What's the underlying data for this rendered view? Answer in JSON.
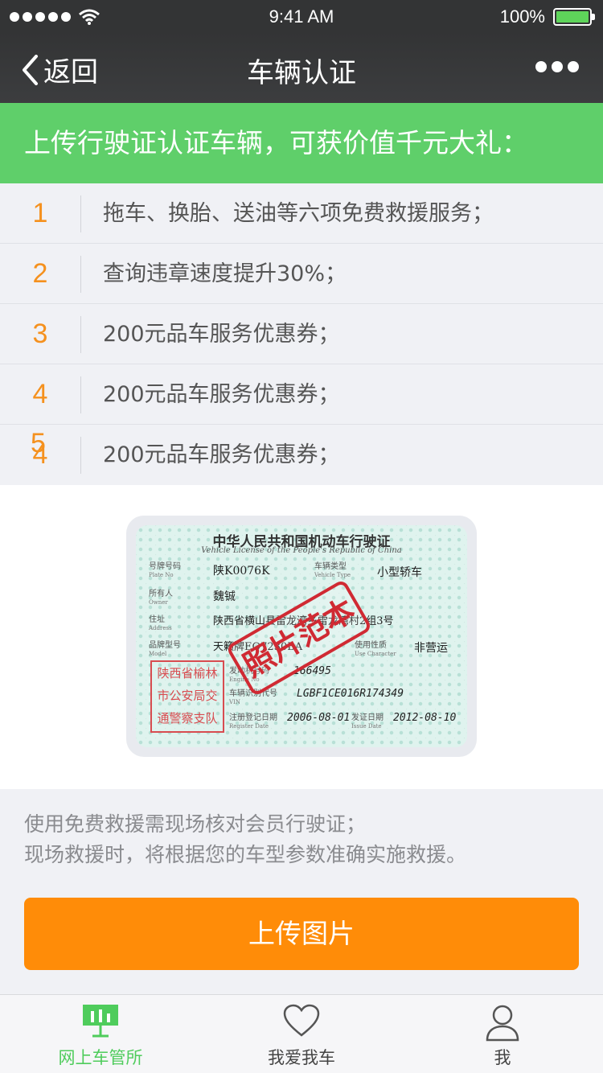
{
  "status_bar": {
    "time": "9:41 AM",
    "battery": "100%"
  },
  "nav": {
    "back_label": "返回",
    "title": "车辆认证"
  },
  "banner": {
    "text": "上传行驶证认证车辆，可获价值千元大礼："
  },
  "benefits": [
    {
      "num": "1",
      "text": "拖车、换胎、送油等六项免费救援服务；"
    },
    {
      "num": "2",
      "text": "查询违章速度提升30%；"
    },
    {
      "num": "3",
      "text": "200元品车服务优惠券；"
    },
    {
      "num": "4",
      "text": "200元品车服务优惠券；"
    },
    {
      "num": "4",
      "num_overlap": "5",
      "text": "200元品车服务优惠券；"
    }
  ],
  "license": {
    "title": "中华人民共和国机动车行驶证",
    "subtitle": "Vehicle License of the People's Republic of China",
    "plate_label": "号牌号码",
    "plate_label_en": "Plate No",
    "plate": "陕K0076K",
    "type_label": "车辆类型",
    "type_label_en": "Vehicle Type",
    "type": "小型轿车",
    "owner_label": "所有人",
    "owner_label_en": "Owner",
    "owner": "魏铖",
    "address_label": "住址",
    "address_label_en": "Address",
    "address": "陕西省横山县雷龙湾乡雷龙湾村2组3号",
    "model_label": "品牌型号",
    "model_label_en": "Model",
    "model": "天籁牌EQ7230BA",
    "use_label": "使用性质",
    "use_label_en": "Use Character",
    "use": "非营运",
    "engine_label": "发动机号码",
    "engine_label_en": "Engine No",
    "engine": "166495",
    "vin_label": "车辆识别代号",
    "vin_label_en": "VIN",
    "vin": "LGBF1CE016R174349",
    "register_label": "注册登记日期",
    "register_label_en": "Register Date",
    "register_date": "2006-08-01",
    "issue_label": "发证日期",
    "issue_label_en": "Issue Date",
    "issue_date": "2012-08-10",
    "seal": [
      "陕西省榆林",
      "市公安局交",
      "通警察支队"
    ],
    "stamp": "照片范本"
  },
  "note": {
    "line1": "使用免费救援需现场核对会员行驶证；",
    "line2": "现场救援时，将根据您的车型参数准确实施救援。"
  },
  "upload_button": "上传图片",
  "tabs": [
    {
      "label": "网上车管所",
      "icon": "chart-board-icon",
      "active": true
    },
    {
      "label": "我爱我车",
      "icon": "heart-icon",
      "active": false
    },
    {
      "label": "我",
      "icon": "user-icon",
      "active": false
    }
  ],
  "colors": {
    "accent_green": "#5fcf6a",
    "accent_orange": "#ff8c08",
    "number_orange": "#f5911e"
  }
}
